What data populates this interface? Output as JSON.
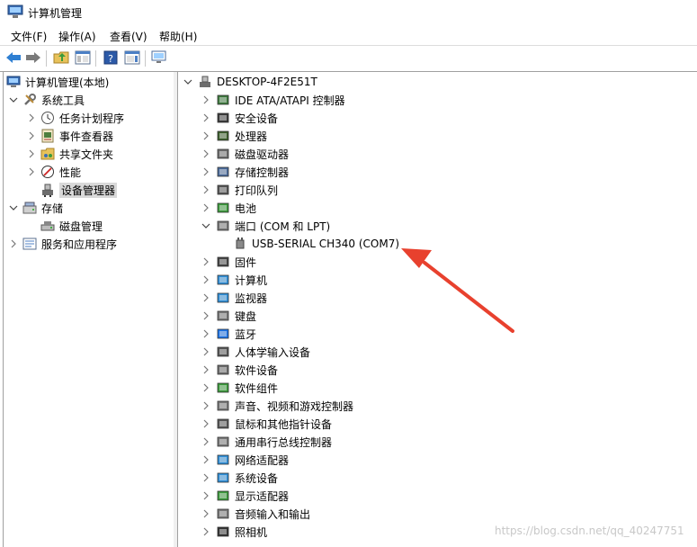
{
  "window": {
    "title": "计算机管理"
  },
  "menu": [
    "文件(F)",
    "操作(A)",
    "查看(V)",
    "帮助(H)"
  ],
  "left_tree": {
    "root": "计算机管理(本地)",
    "system_tools": "系统工具",
    "task_scheduler": "任务计划程序",
    "event_viewer": "事件查看器",
    "shared_folders": "共享文件夹",
    "performance": "性能",
    "device_manager": "设备管理器",
    "storage": "存储",
    "disk_management": "磁盘管理",
    "services_apps": "服务和应用程序"
  },
  "device_tree": {
    "computer_name": "DESKTOP-4F2E51T",
    "ports_child": "USB-SERIAL CH340 (COM7)",
    "categories": [
      "IDE ATA/ATAPI 控制器",
      "安全设备",
      "处理器",
      "磁盘驱动器",
      "存储控制器",
      "打印队列",
      "电池",
      "端口 (COM 和 LPT)",
      "固件",
      "计算机",
      "监视器",
      "键盘",
      "蓝牙",
      "人体学输入设备",
      "软件设备",
      "软件组件",
      "声音、视频和游戏控制器",
      "鼠标和其他指针设备",
      "通用串行总线控制器",
      "网络适配器",
      "系统设备",
      "显示适配器",
      "音频输入和输出",
      "照相机"
    ]
  },
  "watermark": "https://blog.csdn.net/qq_40247751",
  "colors": {
    "arrow": "#e8412e",
    "selected_bg": "#d9d9d9",
    "border": "#a0a0a0"
  }
}
